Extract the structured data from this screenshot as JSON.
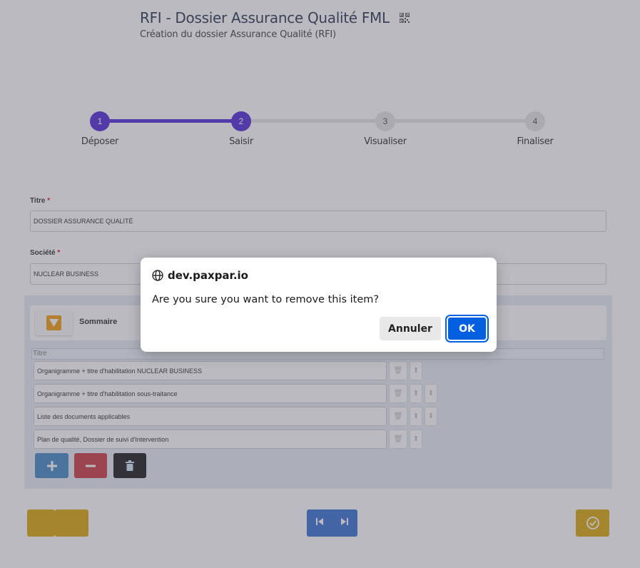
{
  "header": {
    "title": "RFI - Dossier Assurance Qualité FML",
    "subtitle": "Création du dossier Assurance Qualité (RFI)"
  },
  "stepper": {
    "steps": [
      {
        "number": "1",
        "label": "Déposer",
        "state": "done"
      },
      {
        "number": "2",
        "label": "Saisir",
        "state": "current"
      },
      {
        "number": "3",
        "label": "Visualiser",
        "state": "pending"
      },
      {
        "number": "4",
        "label": "Finaliser",
        "state": "pending"
      }
    ],
    "colors": {
      "active": "#4b1fd6",
      "inactive": "#e3e3e3"
    }
  },
  "form": {
    "titre": {
      "label": "Titre",
      "required_mark": "*",
      "value": "DOSSIER ASSURANCE QUALITÉ"
    },
    "societe": {
      "label": "Société",
      "required_mark": "*",
      "value": "NUCLEAR BUSINESS"
    }
  },
  "sommaire": {
    "title": "Sommaire",
    "column_header": "Titre",
    "rows": [
      "Organigramme + titre d'habilitation NUCLEAR BUSINESS",
      "Organigramme + titre d'habilitation sous-traitance",
      "Liste des documents applicables",
      "Plan de qualité, Dossier de suivi d'Intervention"
    ],
    "actions": [
      {
        "icon": "plus-icon",
        "color": "#3b82c4"
      },
      {
        "icon": "minus-icon",
        "color": "#c9323a"
      },
      {
        "icon": "trash-icon",
        "color": "#111111"
      }
    ]
  },
  "footer": {
    "colors": {
      "yellow": "#d9a400",
      "blue": "#2f6ad1"
    }
  },
  "dialog": {
    "origin": "dev.paxpar.io",
    "message": "Are you sure you want to remove this item?",
    "cancel_label": "Annuler",
    "ok_label": "OK"
  }
}
